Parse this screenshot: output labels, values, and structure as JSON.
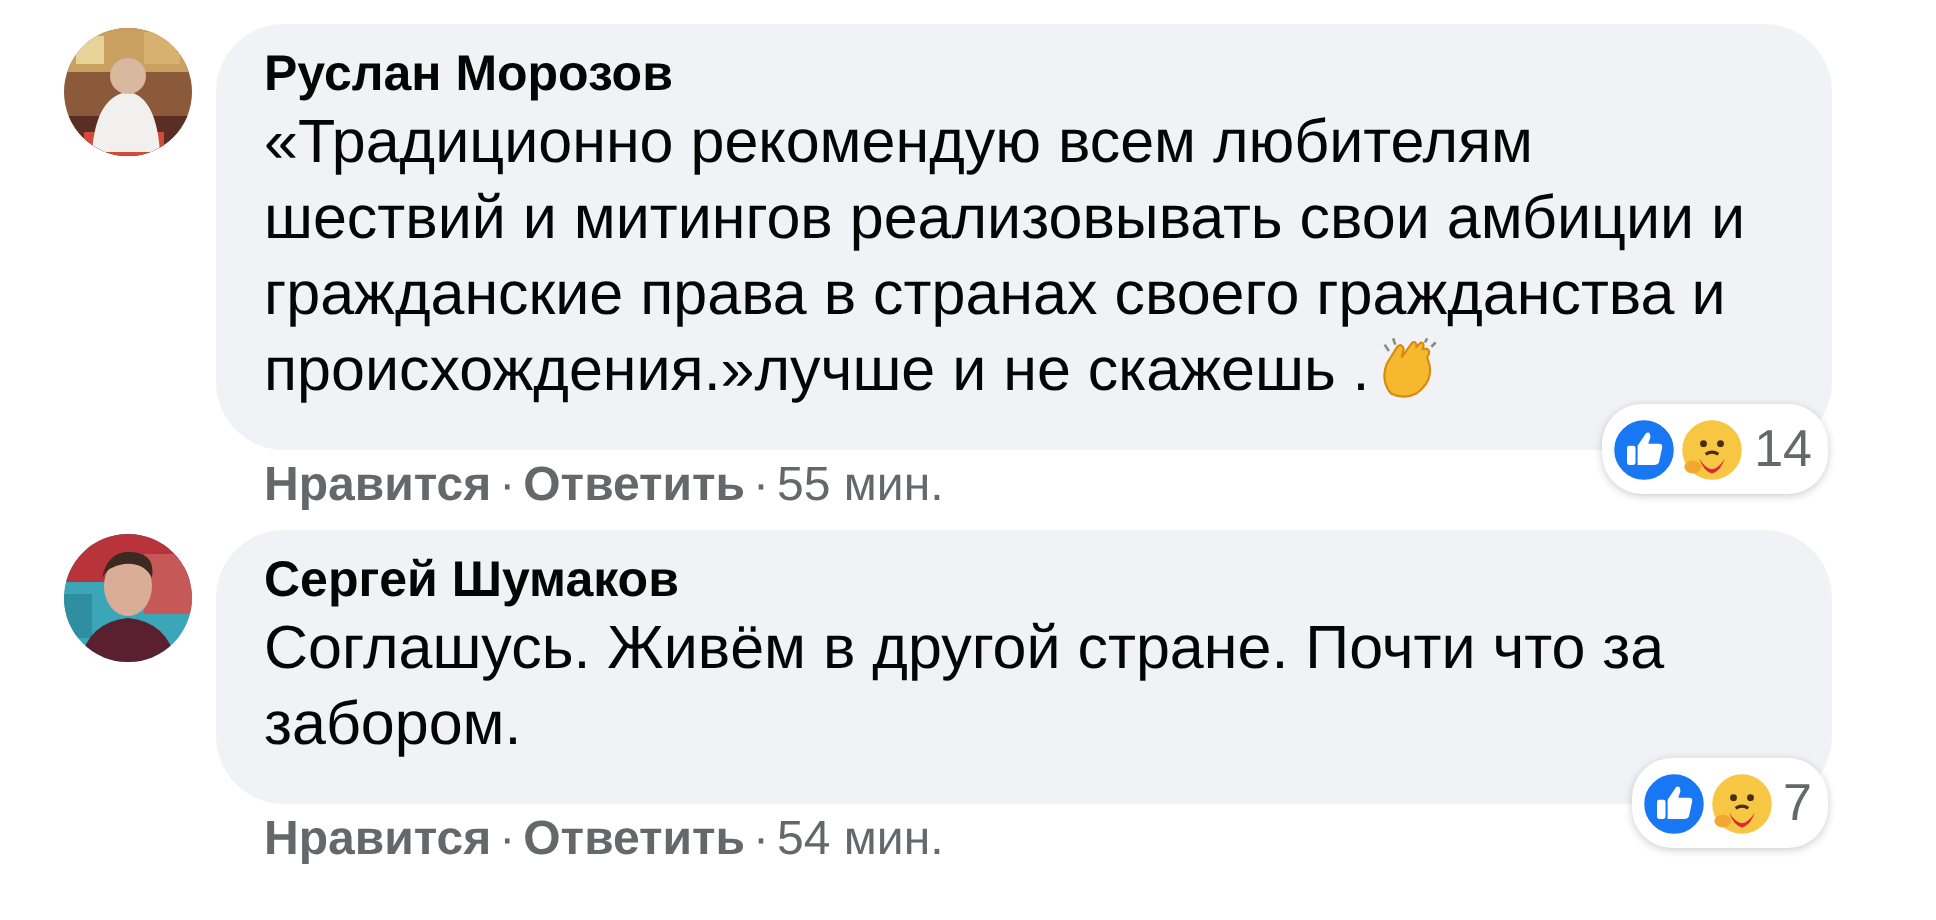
{
  "comments": [
    {
      "author": "Руслан Морозов",
      "text": "«Традиционно рекомендую всем любителям шествий и митингов реализовывать свои амбиции и гражданские права в странах своего гражданства и происхождения.»лучше и не скажешь .",
      "clap_emoji": true,
      "reactions": {
        "count": "14"
      },
      "actions": {
        "like": "Нравится",
        "separator_1": "·",
        "reply": "Ответить",
        "separator_2": "·",
        "time": "55 мин."
      }
    },
    {
      "author": "Сергей Шумаков",
      "text": "Соглашусь. Живём в другой стране. Почти что за забором.",
      "clap_emoji": false,
      "reactions": {
        "count": "7"
      },
      "actions": {
        "like": "Нравится",
        "separator_1": "·",
        "reply": "Ответить",
        "separator_2": "·",
        "time": "54 мин."
      }
    }
  ]
}
